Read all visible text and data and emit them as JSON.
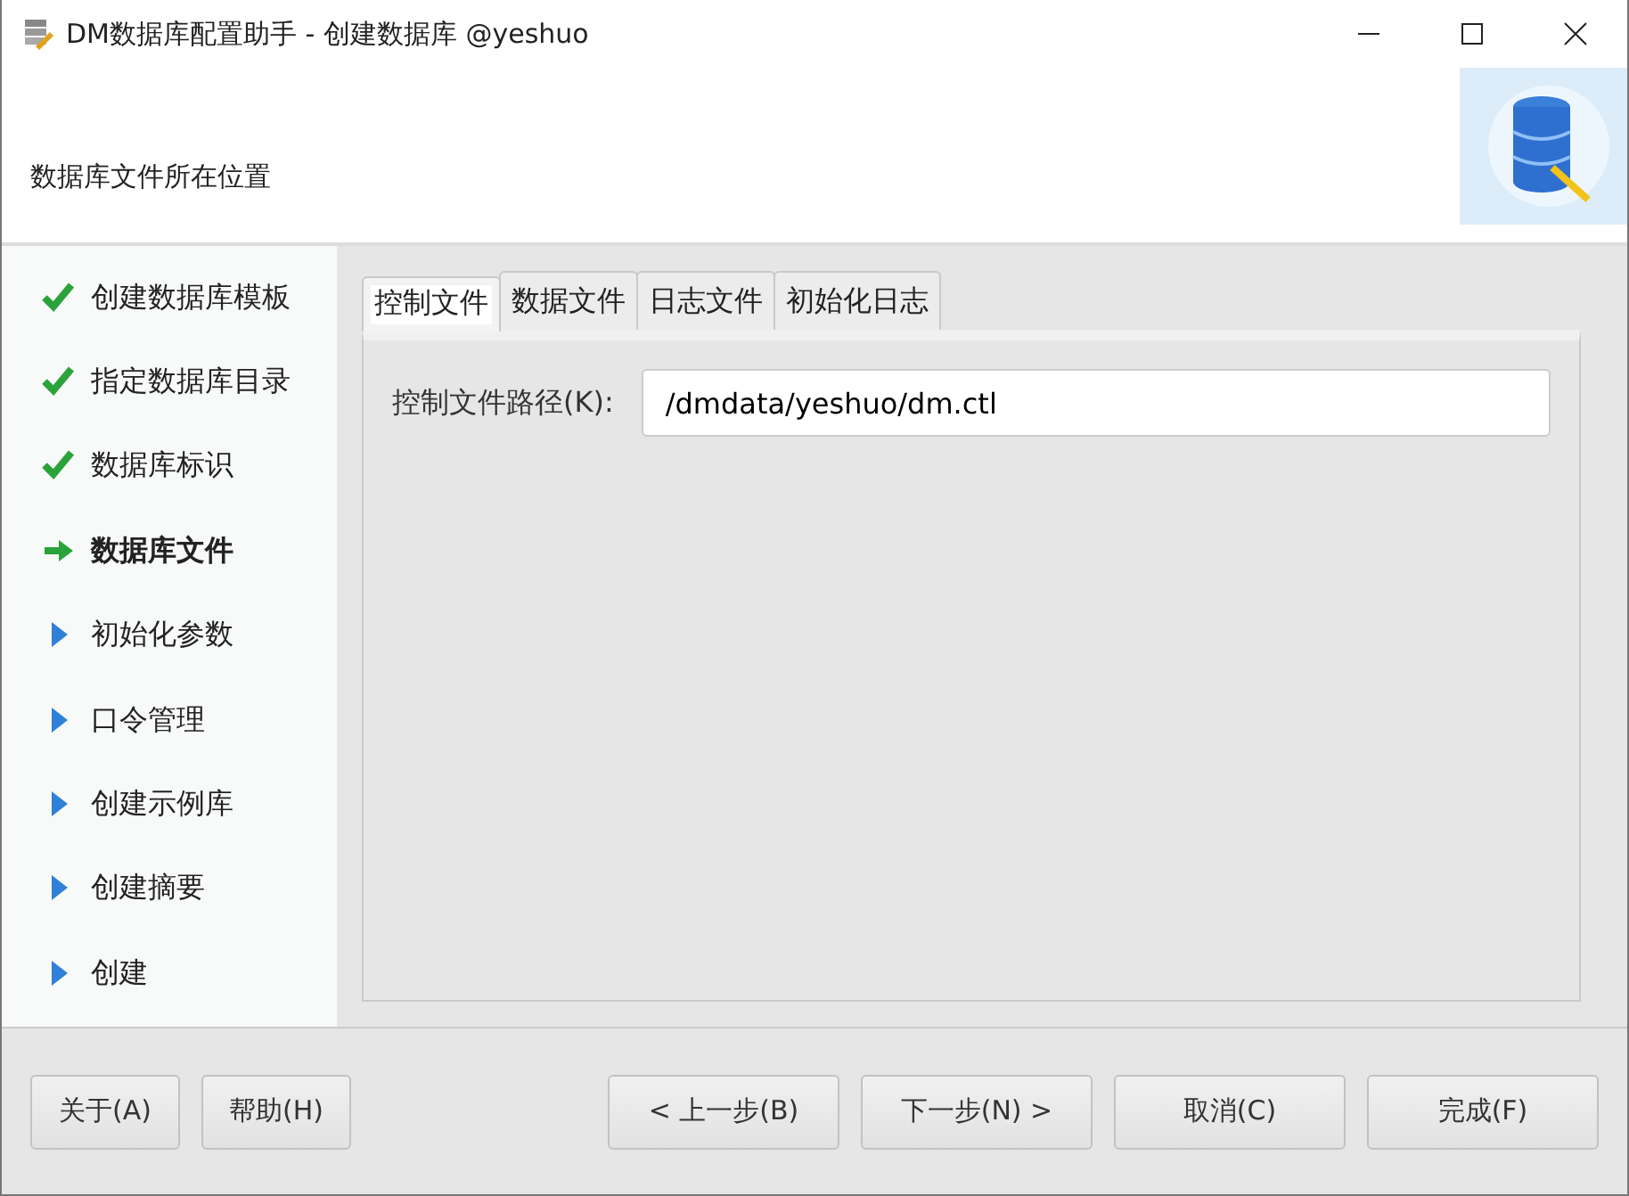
{
  "window": {
    "title": "DM数据库配置助手 - 创建数据库 @yeshuo"
  },
  "header": {
    "title": "数据库文件所在位置"
  },
  "steps": [
    {
      "label": "创建数据库模板",
      "kind": "done"
    },
    {
      "label": "指定数据库目录",
      "kind": "done"
    },
    {
      "label": "数据库标识",
      "kind": "done"
    },
    {
      "label": "数据库文件",
      "kind": "current"
    },
    {
      "label": "初始化参数",
      "kind": "pending"
    },
    {
      "label": "口令管理",
      "kind": "pending"
    },
    {
      "label": "创建示例库",
      "kind": "pending"
    },
    {
      "label": "创建摘要",
      "kind": "pending"
    },
    {
      "label": "创建",
      "kind": "pending"
    }
  ],
  "tabs": [
    {
      "label": "控制文件",
      "selected": true
    },
    {
      "label": "数据文件",
      "selected": false
    },
    {
      "label": "日志文件",
      "selected": false
    },
    {
      "label": "初始化日志",
      "selected": false
    }
  ],
  "field": {
    "label": "控制文件路径(K):",
    "value": "/dmdata/yeshuo/dm.ctl"
  },
  "buttons_left": [
    "关于(A)",
    "帮助(H)"
  ],
  "buttons_right": [
    "< 上一步(B)",
    "下一步(N) >",
    "取消(C)",
    "完成(F)"
  ]
}
